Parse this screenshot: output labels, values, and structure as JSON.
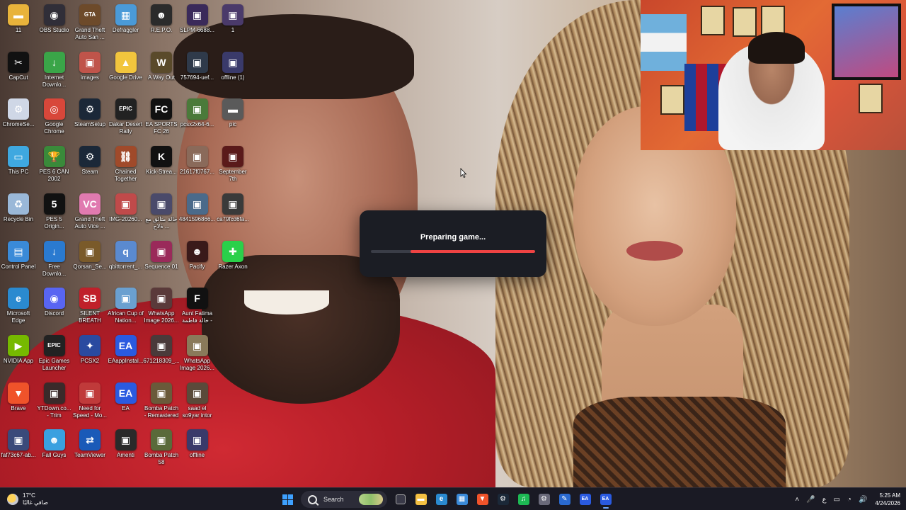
{
  "desktop": {
    "icons": [
      {
        "label": "11",
        "color": "#e8b33b",
        "glyph": "▬"
      },
      {
        "label": "OBS Studio",
        "color": "#302e38",
        "glyph": "◉"
      },
      {
        "label": "Grand Theft Auto San ...",
        "color": "#6d4a2a",
        "glyph": "GTA"
      },
      {
        "label": "Defraggler",
        "color": "#4a9ad8",
        "glyph": "▦"
      },
      {
        "label": "R.E.P.O.",
        "color": "#2b2b2b",
        "glyph": "☻"
      },
      {
        "label": "SLPM-6688...",
        "color": "#3a2a5a",
        "glyph": "▣"
      },
      {
        "label": "1",
        "color": "#4a3a6a",
        "glyph": "▣"
      },
      {
        "label": "CapCut",
        "color": "#111111",
        "glyph": "✂"
      },
      {
        "label": "Internet Downlo...",
        "color": "#3aa548",
        "glyph": "↓"
      },
      {
        "label": "images",
        "color": "#c0544a",
        "glyph": "▣"
      },
      {
        "label": "Google Drive",
        "color": "#f2c53d",
        "glyph": "▲"
      },
      {
        "label": "A Way Out",
        "color": "#5a4a2a",
        "glyph": "W"
      },
      {
        "label": "757694-uef...",
        "color": "#2f3a4a",
        "glyph": "▣"
      },
      {
        "label": "offline (1)",
        "color": "#3a3a6a",
        "glyph": "▣"
      },
      {
        "label": "ChromeSe...",
        "color": "#cfd7e6",
        "glyph": "⚙"
      },
      {
        "label": "Google Chrome",
        "color": "#d8473a",
        "glyph": "◎"
      },
      {
        "label": "SteamSetup",
        "color": "#1b2838",
        "glyph": "⚙"
      },
      {
        "label": "Dakar Desert Rally",
        "color": "#222222",
        "glyph": "EPIC"
      },
      {
        "label": "EA SPORTS FC 26",
        "color": "#111111",
        "glyph": "FC"
      },
      {
        "label": "pcsx2x64-6...",
        "color": "#4a7a3a",
        "glyph": "▣"
      },
      {
        "label": "pic",
        "color": "#5a5a5a",
        "glyph": "▬"
      },
      {
        "label": "This PC",
        "color": "#3fa8e0",
        "glyph": "▭"
      },
      {
        "label": "PES 6 CAN 2002",
        "color": "#3a8a3a",
        "glyph": "🏆"
      },
      {
        "label": "Steam",
        "color": "#1b2838",
        "glyph": "⚙"
      },
      {
        "label": "Chained Together",
        "color": "#a04a2a",
        "glyph": "⛓"
      },
      {
        "label": "Kick-Strea...",
        "color": "#111111",
        "glyph": "K"
      },
      {
        "label": "21617f0767...",
        "color": "#8a6a5a",
        "glyph": "▣"
      },
      {
        "label": "September 7th",
        "color": "#5a1a1a",
        "glyph": "▣"
      },
      {
        "label": "Recycle Bin",
        "color": "#9ab8d8",
        "glyph": "♻"
      },
      {
        "label": "PES 5 Origin...",
        "color": "#111111",
        "glyph": "5"
      },
      {
        "label": "Grand Theft Auto Vice ...",
        "color": "#e07ab0",
        "glyph": "VC"
      },
      {
        "label": "IMG-20260...",
        "color": "#c04a4a",
        "glyph": "▣"
      },
      {
        "label": "حالة متألق مع ... ةلاح",
        "color": "#4a4a6a",
        "glyph": "▣"
      },
      {
        "label": "4841596866...",
        "color": "#4a6a8a",
        "glyph": "▣"
      },
      {
        "label": "ca79fcd6fa...",
        "color": "#3a3a3a",
        "glyph": "▣"
      },
      {
        "label": "Control Panel",
        "color": "#3a8ad8",
        "glyph": "▤"
      },
      {
        "label": "Free Downlo...",
        "color": "#2a7ad0",
        "glyph": "↓"
      },
      {
        "label": "Qorsan_Se...",
        "color": "#7a5a2a",
        "glyph": "▣"
      },
      {
        "label": "qbittorrent_...",
        "color": "#5a8ad0",
        "glyph": "q"
      },
      {
        "label": "Sequence 01",
        "color": "#9a2a5a",
        "glyph": "▣"
      },
      {
        "label": "Pacify",
        "color": "#3a1a1a",
        "glyph": "☻"
      },
      {
        "label": "Razer Axon",
        "color": "#2ad04a",
        "glyph": "✚"
      },
      {
        "label": "Microsoft Edge",
        "color": "#2a8ad0",
        "glyph": "e"
      },
      {
        "label": "Discord",
        "color": "#5865f2",
        "glyph": "◉"
      },
      {
        "label": "SILENT BREATH",
        "color": "#c0202a",
        "glyph": "SB"
      },
      {
        "label": "African Cup of Nation...",
        "color": "#6aa0d0",
        "glyph": "▣"
      },
      {
        "label": "WhatsApp Image 2026...",
        "color": "#5a3a3a",
        "glyph": "▣"
      },
      {
        "label": "Aunt Fatima خالة فاطمة -",
        "color": "#111111",
        "glyph": "F"
      },
      {
        "label": "NVIDIA App",
        "color": "#76b900",
        "glyph": "▶"
      },
      {
        "label": "Epic Games Launcher",
        "color": "#222222",
        "glyph": "EPIC"
      },
      {
        "label": "PCSX2",
        "color": "#2a4aa0",
        "glyph": "✦"
      },
      {
        "label": "EAappInstal...",
        "color": "#2a5ae0",
        "glyph": "EA"
      },
      {
        "label": "671218309_...",
        "color": "#4a3a3a",
        "glyph": "▣"
      },
      {
        "label": "WhatsApp Image 2026...",
        "color": "#8a7a5a",
        "glyph": "▣"
      },
      {
        "label": "Brave",
        "color": "#f0532a",
        "glyph": "▼"
      },
      {
        "label": "YTDown.co... - Trim",
        "color": "#3a2a2a",
        "glyph": "▣"
      },
      {
        "label": "Need for Speed - Mo...",
        "color": "#c03a3a",
        "glyph": "▣"
      },
      {
        "label": "EA",
        "color": "#2a5ae0",
        "glyph": "EA"
      },
      {
        "label": "Bomba Patch - Remastered",
        "color": "#6a5a3a",
        "glyph": "▣"
      },
      {
        "label": "saad el so9yar intor",
        "color": "#5a4a3a",
        "glyph": "▣"
      },
      {
        "label": "faf73c67-ab...",
        "color": "#3a4a7a",
        "glyph": "▣"
      },
      {
        "label": "Fall Guys",
        "color": "#3aa0e0",
        "glyph": "☻"
      },
      {
        "label": "TeamViewer",
        "color": "#1a5ab8",
        "glyph": "⇄"
      },
      {
        "label": "Amenti",
        "color": "#2a2a2a",
        "glyph": "▣"
      },
      {
        "label": "Bomba Patch 58",
        "color": "#5a6a3a",
        "glyph": "▣"
      },
      {
        "label": "offline",
        "color": "#3a3a6a",
        "glyph": "▣"
      }
    ]
  },
  "dialog": {
    "text": "Preparing game...",
    "progress_start": 0.24,
    "progress_end": 1.0,
    "track_color": "#3a3d47",
    "fill_color": "#ef4343"
  },
  "taskbar": {
    "weather": {
      "temp": "17°C",
      "condition": "صافي غالبًا",
      "icon": "partly-sunny-icon"
    },
    "search_placeholder": "Search",
    "apps": [
      {
        "name": "file-explorer",
        "glyph": "▬",
        "color": "#f4c042"
      },
      {
        "name": "edge",
        "glyph": "e",
        "color": "#2a8ad0"
      },
      {
        "name": "store",
        "glyph": "▦",
        "color": "#3a8ad8"
      },
      {
        "name": "brave",
        "glyph": "▼",
        "color": "#f0532a"
      },
      {
        "name": "steam",
        "glyph": "⚙",
        "color": "#1b2838"
      },
      {
        "name": "spotify",
        "glyph": "♫",
        "color": "#1db954"
      },
      {
        "name": "settings",
        "glyph": "⚙",
        "color": "#6a6a7a"
      },
      {
        "name": "word-pad",
        "glyph": "✎",
        "color": "#2a6ad0"
      },
      {
        "name": "ea-app",
        "glyph": "EA",
        "color": "#2a5ae0"
      },
      {
        "name": "ea-app-active",
        "glyph": "EA",
        "color": "#2a5ae0"
      }
    ],
    "tray": {
      "lang": "ع",
      "time": "5:25 AM",
      "date": "4/24/2026"
    }
  }
}
